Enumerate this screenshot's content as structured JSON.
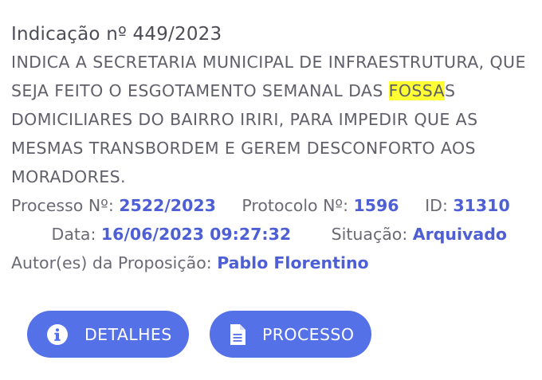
{
  "title": "Indicação nº 449/2023",
  "summary": {
    "before": "INDICA A SECRETARIA MUNICIPAL DE INFRAESTRUTURA, QUE SEJA FEITO O ESGOTAMENTO SEMANAL DAS ",
    "highlight": "FOSSA",
    "after": "S DOMICILIARES DO BAIRRO IRIRI, PARA IMPEDIR QUE AS MESMAS TRANSBORDEM E GEREM DESCONFORTO AOS MORADORES."
  },
  "meta": {
    "processo_label": "Processo Nº:",
    "processo_value": "2522/2023",
    "protocolo_label": "Protocolo Nº:",
    "protocolo_value": "1596",
    "id_label": "ID:",
    "id_value": "31310",
    "data_label": "Data:",
    "data_value": "16/06/2023 09:27:32",
    "situacao_label": "Situação:",
    "situacao_value": "Arquivado",
    "autor_label": "Autor(es) da Proposição:",
    "autor_value": "Pablo Florentino"
  },
  "buttons": {
    "detalhes": {
      "label": "DETALHES",
      "icon": "info-circle-icon"
    },
    "processo": {
      "label": "PROCESSO",
      "icon": "document-icon"
    }
  },
  "colors": {
    "accent": "#5571e8",
    "link": "#4e5fd6",
    "highlight": "#ffff33"
  }
}
